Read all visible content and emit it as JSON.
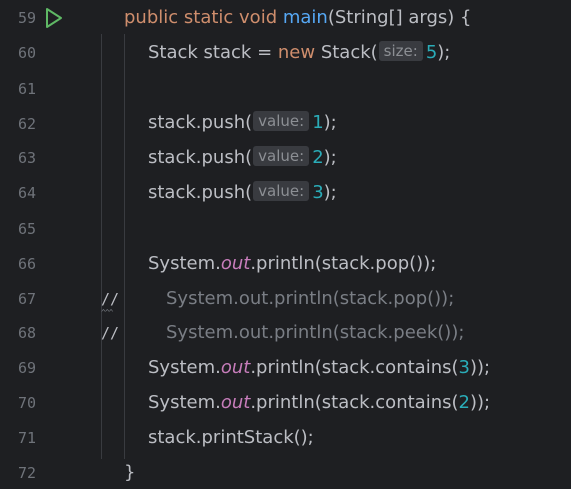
{
  "gutter": {
    "line_numbers": [
      "59",
      "60",
      "61",
      "62",
      "63",
      "64",
      "65",
      "66",
      "67",
      "68",
      "69",
      "70",
      "71",
      "72"
    ],
    "comment_marker": "//",
    "squiggle": "^^^"
  },
  "code": {
    "l59": {
      "kw": "public static void ",
      "method": "main",
      "rest": "(String[] args) {"
    },
    "l60": {
      "pre": "Stack stack = ",
      "kw_new": "new",
      "post": " Stack(",
      "hint": "size:",
      "num": "5",
      "end": ");"
    },
    "l62": {
      "pre": "stack.push(",
      "hint": "value:",
      "num": "1",
      "end": ");"
    },
    "l63": {
      "pre": "stack.push(",
      "hint": "value:",
      "num": "2",
      "end": ");"
    },
    "l64": {
      "pre": "stack.push(",
      "hint": "value:",
      "num": "3",
      "end": ");"
    },
    "l66": {
      "pre": "System.",
      "field": "out",
      "post": ".println(stack.pop());"
    },
    "l67": {
      "comment": "System.out.println(stack.pop());"
    },
    "l68": {
      "comment": "System.out.println(stack.peek());"
    },
    "l69": {
      "pre": "System.",
      "field": "out",
      "post": ".println(stack.contains(",
      "num": "3",
      "end": "));"
    },
    "l70": {
      "pre": "System.",
      "field": "out",
      "post": ".println(stack.contains(",
      "num": "2",
      "end": "));"
    },
    "l71": {
      "text": "stack.printStack();"
    },
    "l72": {
      "text": "}"
    }
  },
  "colors": {
    "background": "#1e1f22",
    "keyword": "#cf8e6d",
    "method": "#56a8f5",
    "number": "#2aacb8",
    "static_field": "#c77dbb",
    "comment": "#7a7e85",
    "run_icon": "#5fb865"
  },
  "icons": {
    "run": "run-gutter-icon"
  }
}
